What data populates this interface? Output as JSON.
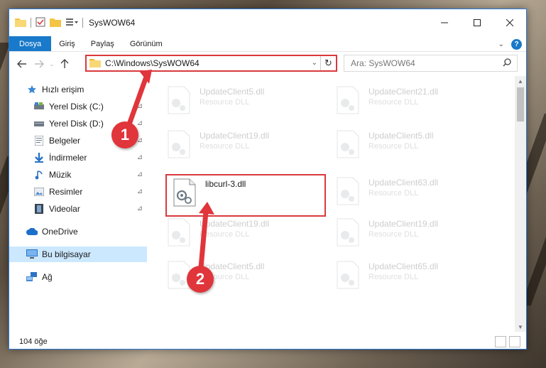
{
  "window": {
    "title": "SysWOW64"
  },
  "ribbon": {
    "tabs": [
      "Dosya",
      "Giriş",
      "Paylaş",
      "Görünüm"
    ]
  },
  "address": {
    "path": "C:\\Windows\\SysWOW64"
  },
  "search": {
    "placeholder": "Ara: SysWOW64"
  },
  "sidebar": {
    "items": [
      {
        "label": "Hızlı erişim",
        "icon": "star-icon"
      },
      {
        "label": "Yerel Disk (C:)",
        "icon": "drive-icon"
      },
      {
        "label": "Yerel Disk (D:)",
        "icon": "drive-icon"
      },
      {
        "label": "Belgeler",
        "icon": "documents-icon"
      },
      {
        "label": "İndirmeler",
        "icon": "download-icon"
      },
      {
        "label": "Müzik",
        "icon": "music-icon"
      },
      {
        "label": "Resimler",
        "icon": "pictures-icon"
      },
      {
        "label": "Videolar",
        "icon": "video-icon"
      },
      {
        "label": "OneDrive",
        "icon": "cloud-icon"
      },
      {
        "label": "Bu bilgisayar",
        "icon": "computer-icon"
      },
      {
        "label": "Ağ",
        "icon": "network-icon"
      }
    ]
  },
  "files": [
    {
      "name": "UpdateClient5.dll",
      "type": "Resource DLL"
    },
    {
      "name": "UpdateClient21.dll",
      "type": "Resource DLL"
    },
    {
      "name": "UpdateClient19.dll",
      "type": "Resource DLL"
    },
    {
      "name": "UpdateClient5.dll",
      "type": "Resource DLL"
    },
    {
      "name": "libcurl-3.dll",
      "type": ""
    },
    {
      "name": "UpdateClient63.dll",
      "type": "Resource DLL"
    },
    {
      "name": "UpdateClient19.dll",
      "type": "Resource DLL"
    },
    {
      "name": "UpdateClient19.dll",
      "type": "Resource DLL"
    },
    {
      "name": "UpdateClient5.dll",
      "type": "Resource DLL"
    },
    {
      "name": "UpdateClient65.dll",
      "type": "Resource DLL"
    }
  ],
  "status": {
    "count": "104 öğe"
  },
  "annotations": {
    "step1": "1",
    "step2": "2"
  },
  "colors": {
    "accent": "#1979ca",
    "highlight": "#d9393d",
    "selected": "#cce8ff"
  }
}
